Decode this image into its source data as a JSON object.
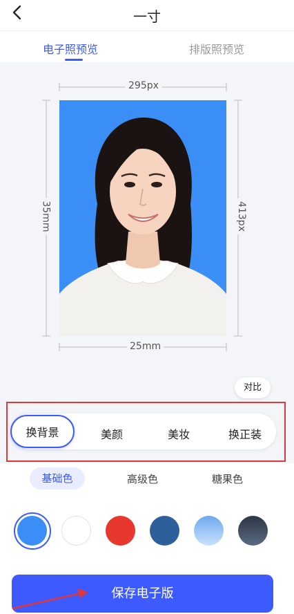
{
  "header": {
    "title": "一寸"
  },
  "tabs": [
    {
      "label": "电子照预览",
      "active": true
    },
    {
      "label": "排版照预览",
      "active": false
    }
  ],
  "preview": {
    "width_px_label": "295px",
    "height_px_label": "413px",
    "width_mm_label": "25mm",
    "height_mm_label": "35mm",
    "background_color": "#3b8ef5"
  },
  "compare_label": "对比",
  "functions": [
    {
      "label": "换背景",
      "active": true
    },
    {
      "label": "美颜",
      "active": false
    },
    {
      "label": "美妆",
      "active": false
    },
    {
      "label": "换正装",
      "active": false
    }
  ],
  "color_categories": [
    {
      "label": "基础色",
      "active": true
    },
    {
      "label": "高级色",
      "active": false
    },
    {
      "label": "糖果色",
      "active": false
    }
  ],
  "swatches": [
    {
      "name": "blue",
      "color": "#3b8ef5",
      "selected": true
    },
    {
      "name": "white",
      "color": "#ffffff",
      "selected": false
    },
    {
      "name": "red",
      "color": "#e8372c",
      "selected": false
    },
    {
      "name": "dark-blue",
      "color": "#2d5f9a",
      "selected": false
    },
    {
      "name": "blue-gradient",
      "color": "#8fc1f5",
      "selected": false
    },
    {
      "name": "gray-gradient",
      "color": "#3e4a5c",
      "selected": false
    }
  ],
  "save_label": "保存电子版",
  "accent": "#3d5afe"
}
